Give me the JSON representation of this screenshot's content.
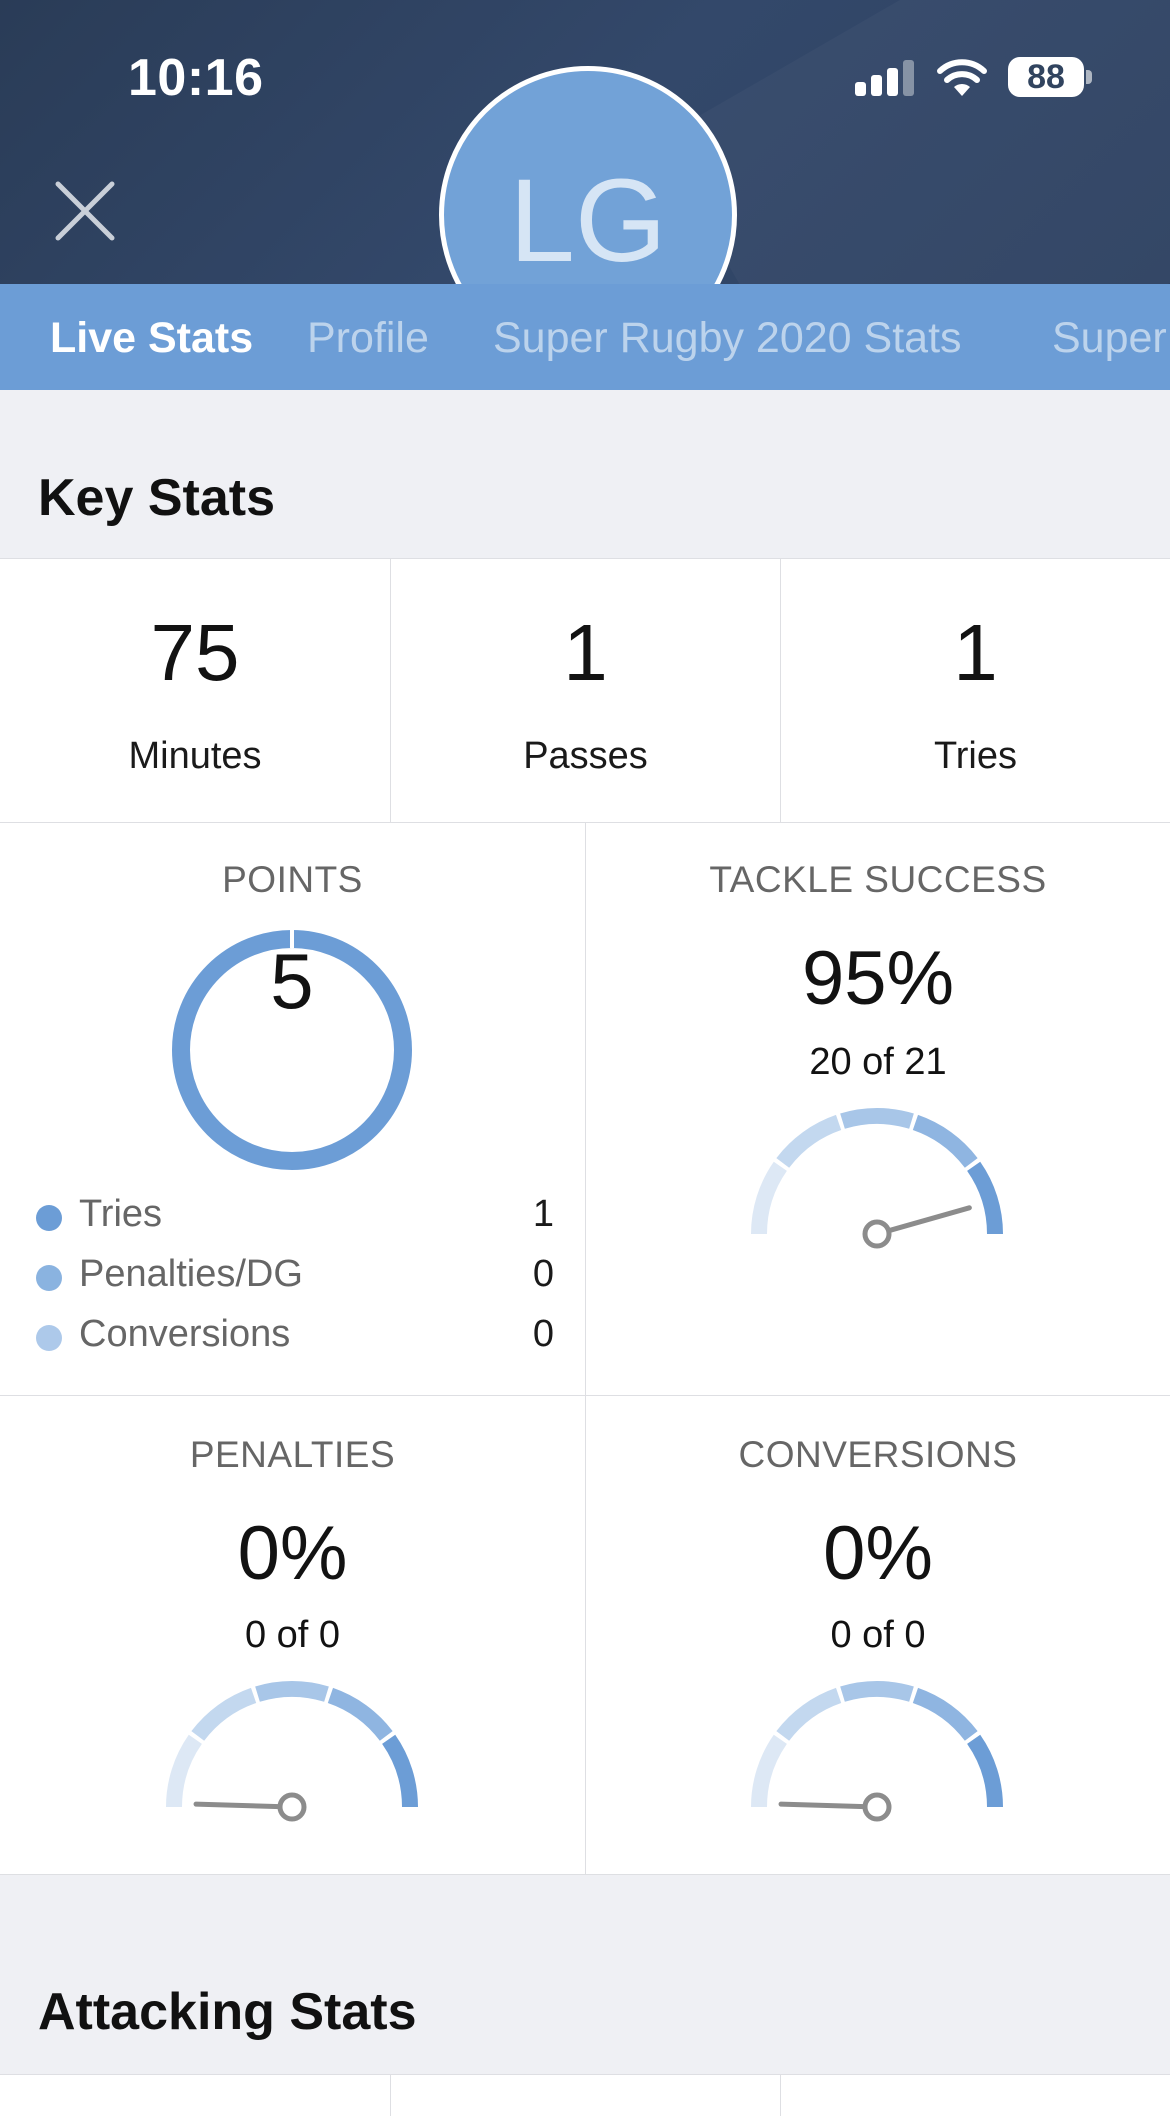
{
  "status_bar": {
    "time": "10:16",
    "battery": "88"
  },
  "header": {
    "avatar_initials": "LG"
  },
  "tabs": [
    {
      "label": "Live Stats",
      "active": true
    },
    {
      "label": "Profile",
      "active": false
    },
    {
      "label": "Super Rugby 2020 Stats",
      "active": false
    },
    {
      "label": "Super",
      "active": false
    }
  ],
  "key_stats": {
    "title": "Key Stats",
    "items": [
      {
        "value": "75",
        "label": "Minutes"
      },
      {
        "value": "1",
        "label": "Passes"
      },
      {
        "value": "1",
        "label": "Tries"
      }
    ]
  },
  "points": {
    "title": "POINTS",
    "total": "5",
    "legend": [
      {
        "label": "Tries",
        "value": "1",
        "color": "#6c9dd6"
      },
      {
        "label": "Penalties/DG",
        "value": "0",
        "color": "#8ab3e0"
      },
      {
        "label": "Conversions",
        "value": "0",
        "color": "#adc9ea"
      }
    ]
  },
  "tackle_success": {
    "title": "TACKLE SUCCESS",
    "percent": "95%",
    "detail": "20 of 21",
    "fraction": 0.95
  },
  "penalties": {
    "title": "PENALTIES",
    "percent": "0%",
    "detail": "0 of 0",
    "fraction": 0
  },
  "conversions": {
    "title": "CONVERSIONS",
    "percent": "0%",
    "detail": "0 of 0",
    "fraction": 0
  },
  "attacking_stats": {
    "title": "Attacking Stats"
  },
  "colors": {
    "accent": "#6c9dd6",
    "header_dark": "#2b3e5a"
  }
}
